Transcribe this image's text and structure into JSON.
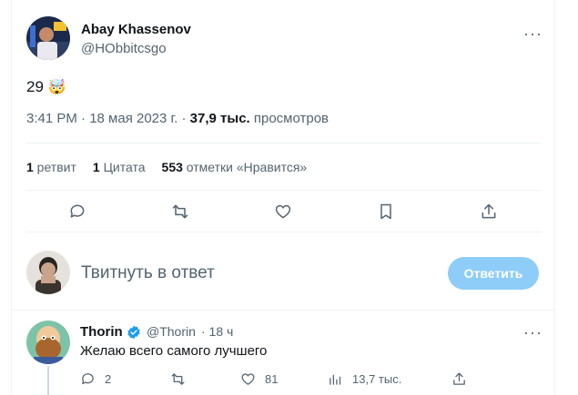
{
  "tweet": {
    "author_name": "Abay Khassenov",
    "author_handle": "@HObbitcsgo",
    "text": "29",
    "emoji": "🤯",
    "time": "3:41 PM · 18 мая 2023 г. · ",
    "views_count": "37,9 тыс.",
    "views_label": " просмотров",
    "retweets_count": "1",
    "retweets_label": " ретвит",
    "quotes_count": "1",
    "quotes_label": " Цитата",
    "likes_count": "553",
    "likes_label": " отметки «Нравится»",
    "more_label": "···"
  },
  "actions": [
    "reply-icon",
    "retweet-icon",
    "like-icon",
    "bookmark-icon",
    "share-icon"
  ],
  "composer": {
    "placeholder": "Твитнуть в ответ",
    "button_label": "Ответить"
  },
  "reply": {
    "author_name": "Thorin",
    "author_handle": "@Thorin",
    "time": "· 18 ч",
    "text": "Желаю всего самого лучшего",
    "replies": "2",
    "likes": "81",
    "views": "13,7 тыс.",
    "more_label": "···"
  },
  "colors": {
    "accent_disabled": "#8ecdf8",
    "verified": "#1d9bf0",
    "muted": "#536471",
    "border": "#eff3f4"
  }
}
